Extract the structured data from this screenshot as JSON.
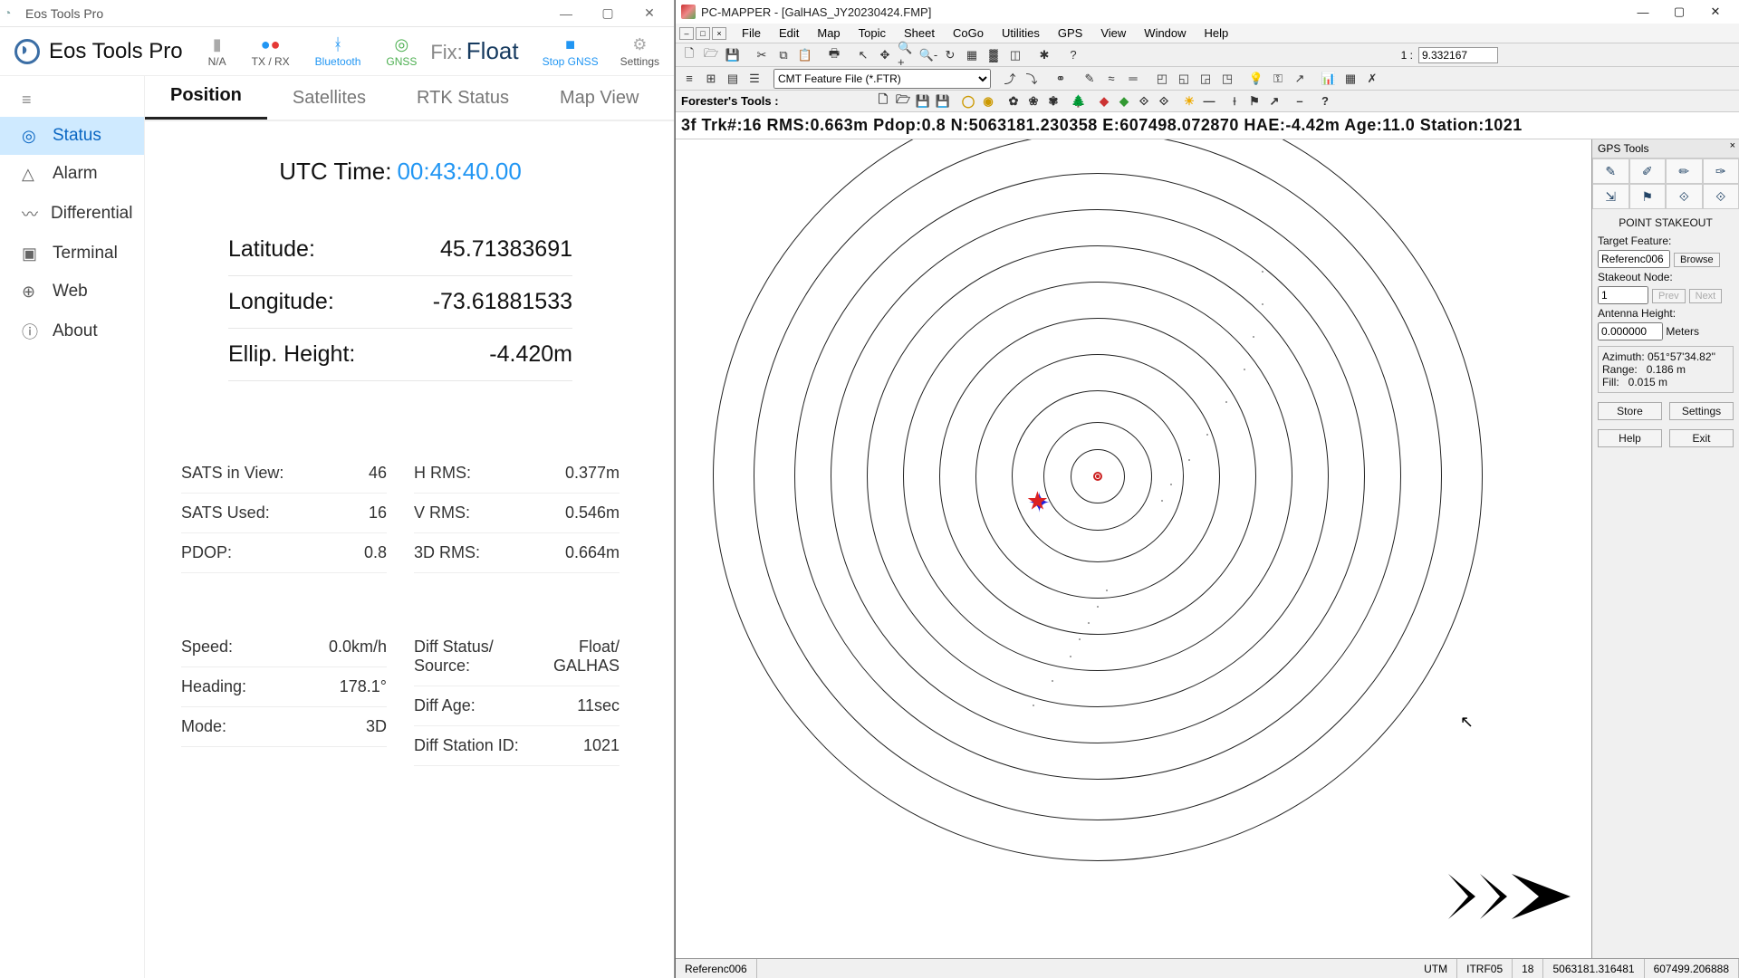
{
  "eos": {
    "title_bar": "Eos Tools Pro",
    "app_title": "Eos Tools Pro",
    "status_icons": {
      "na": "N/A",
      "txrx": "TX / RX",
      "bluetooth": "Bluetooth",
      "gnss": "GNSS"
    },
    "fix_label": "Fix:",
    "fix_value": "Float",
    "stop_label": "Stop GNSS",
    "settings_label": "Settings",
    "sidebar": [
      "Status",
      "Alarm",
      "Differential",
      "Terminal",
      "Web",
      "About"
    ],
    "tabs": [
      "Position",
      "Satellites",
      "RTK Status",
      "Map View"
    ],
    "utc_label": "UTC Time:",
    "utc_value": "00:43:40.00",
    "pos": {
      "lat_label": "Latitude:",
      "lat_val": "45.71383691",
      "lon_label": "Longitude:",
      "lon_val": "-73.61881533",
      "elh_label": "Ellip. Height:",
      "elh_val": "-4.420m"
    },
    "stats1": [
      {
        "k": "SATS in View:",
        "v": "46"
      },
      {
        "k": "SATS Used:",
        "v": "16"
      },
      {
        "k": "PDOP:",
        "v": "0.8"
      }
    ],
    "stats2": [
      {
        "k": "H RMS:",
        "v": "0.377m"
      },
      {
        "k": "V RMS:",
        "v": "0.546m"
      },
      {
        "k": "3D RMS:",
        "v": "0.664m"
      }
    ],
    "stats3": [
      {
        "k": "Speed:",
        "v": "0.0km/h"
      },
      {
        "k": "Heading:",
        "v": "178.1°"
      },
      {
        "k": "Mode:",
        "v": "3D"
      }
    ],
    "stats4": [
      {
        "k": "Diff Status/\nSource:",
        "v": "Float/\nGALHAS"
      },
      {
        "k": "Diff Age:",
        "v": "11sec"
      },
      {
        "k": "Diff Station ID:",
        "v": "1021"
      }
    ]
  },
  "pcm": {
    "title": "PC-MAPPER - [GalHAS_JY20230424.FMP]",
    "menus": [
      "File",
      "Edit",
      "Map",
      "Topic",
      "Sheet",
      "CoGo",
      "Utilities",
      "GPS",
      "View",
      "Window",
      "Help"
    ],
    "scale_prefix": "1 :",
    "scale_value": "9.332167",
    "feature_file": "CMT Feature File (*.FTR)",
    "foresters": "Forester's Tools :",
    "info": "3f Trk#:16  RMS:0.663m  Pdop:0.8  N:5063181.230358  E:607498.072870  HAE:-4.42m  Age:11.0  Station:1021",
    "gps_tools": "GPS Tools",
    "stakeout": {
      "title": "POINT STAKEOUT",
      "target_label": "Target Feature:",
      "target_value": "Referenc006",
      "browse": "Browse",
      "node_label": "Stakeout Node:",
      "node_value": "1",
      "prev": "Prev",
      "next": "Next",
      "antenna_label": "Antenna Height:",
      "antenna_value": "0.000000",
      "antenna_unit": "Meters",
      "azimuth": "Azimuth: 051°57'34.82''",
      "range": "Range:   0.186 m",
      "fill": "Fill:   0.015 m",
      "store": "Store",
      "settings": "Settings",
      "help": "Help",
      "exit": "Exit"
    },
    "status": {
      "ref": "Referenc006",
      "utm": "UTM",
      "itrf": "ITRF05",
      "zone": "18",
      "n": "5063181.316481",
      "e": "607499.206888"
    }
  }
}
